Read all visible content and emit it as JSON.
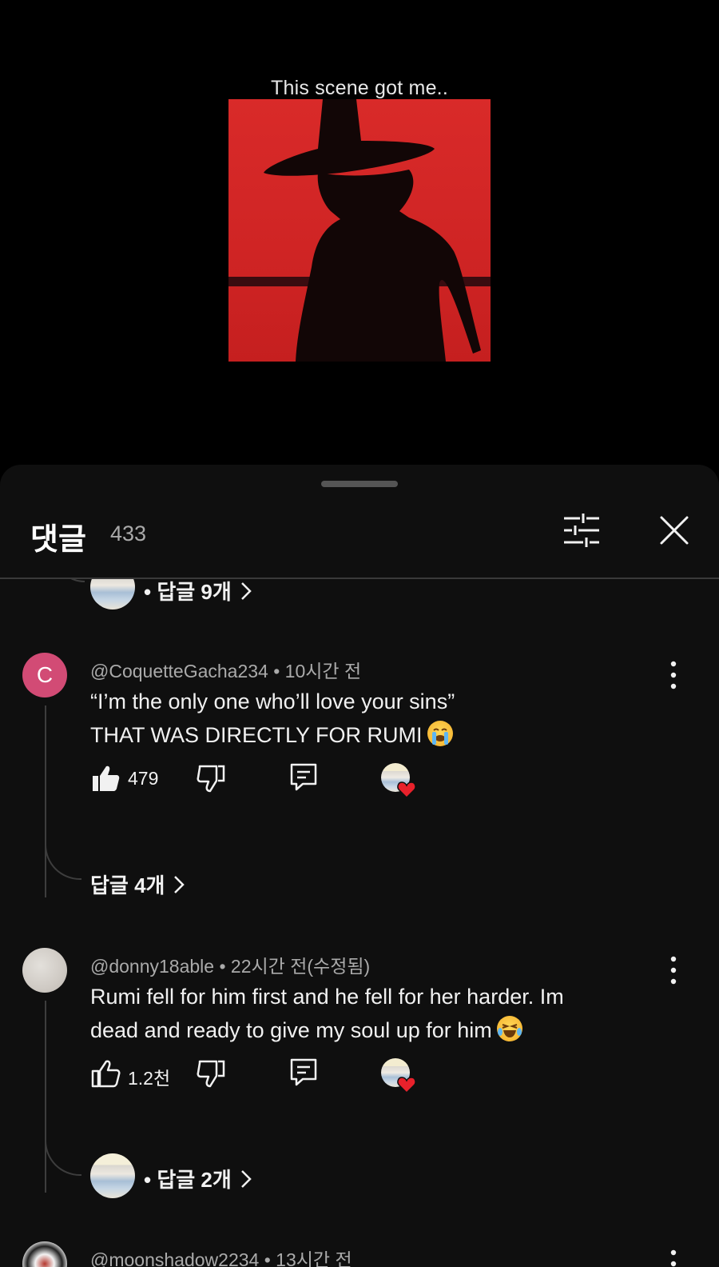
{
  "video": {
    "caption": "This scene got me.."
  },
  "comments_panel": {
    "title": "댓글",
    "count": "433"
  },
  "top_replies": {
    "label": "• 답글 9개"
  },
  "comments": [
    {
      "handle": "@CoquetteGacha234",
      "time": "• 10시간 전",
      "avatar_letter": "C",
      "line1": "“I’m the only one who’ll love your sins”",
      "line2": "THAT WAS DIRECTLY FOR RUMI",
      "emoji": "loudly-crying-face",
      "likes": "479",
      "replies_label": "답글 4개"
    },
    {
      "handle": "@donny18able",
      "time": "• 22시간 전(수정됨)",
      "line1": "Rumi fell for him first and he fell for her harder. Im",
      "line2": "dead and ready to give my soul up for him",
      "emoji": "face-with-tears-of-joy",
      "likes": "1.2천",
      "replies_label": "• 답글 2개"
    },
    {
      "handle": "@moonshadow2234",
      "time": "• 13시간 전"
    }
  ],
  "colors": {
    "background": "#0f0f0f",
    "avatar_c": "#d24b75",
    "heart": "#e8212b"
  }
}
